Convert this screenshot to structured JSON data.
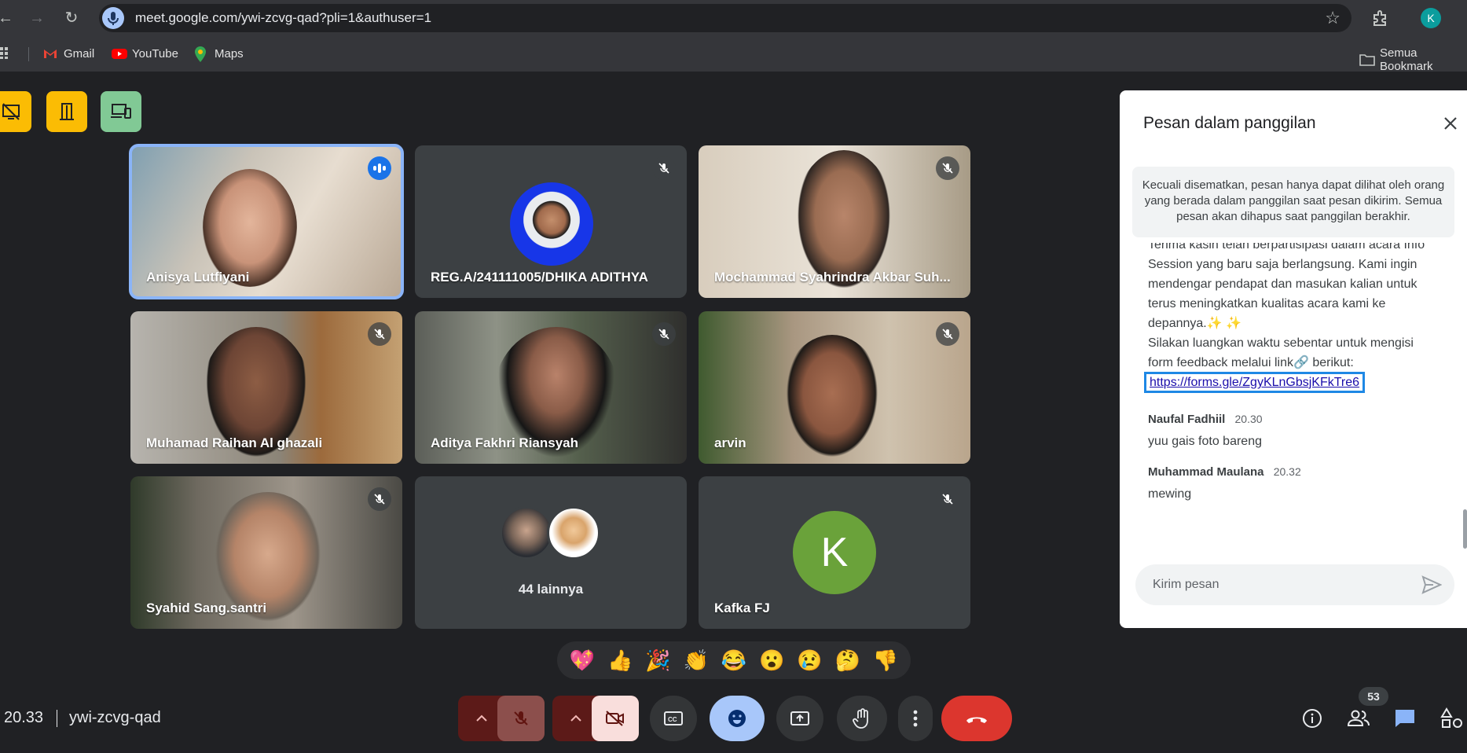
{
  "browser": {
    "url": "meet.google.com/ywi-zcvg-qad?pli=1&authuser=1",
    "profile_initial": "K",
    "bookmarks": [
      {
        "label": "Gmail",
        "icon": "gmail-icon"
      },
      {
        "label": "YouTube",
        "icon": "youtube-icon"
      },
      {
        "label": "Maps",
        "icon": "maps-icon"
      }
    ],
    "bookmarks_folder": "Semua Bookmark"
  },
  "participants": [
    {
      "name": "Anisya Lutfiyani",
      "state": "speaking"
    },
    {
      "name": "REG.A/241111005/DHIKA ADITHYA",
      "state": "muted"
    },
    {
      "name": "Mochammad Syahrindra Akbar Suh...",
      "state": "muted"
    },
    {
      "name": "Muhamad Raihan Al ghazali",
      "state": "muted"
    },
    {
      "name": "Aditya Fakhri Riansyah",
      "state": "muted"
    },
    {
      "name": "arvin",
      "state": "muted"
    },
    {
      "name": "Syahid Sang.santri",
      "state": "muted"
    },
    {
      "name": "44 lainnya",
      "state": "group"
    },
    {
      "name": "Kafka FJ",
      "state": "muted",
      "initial": "K"
    }
  ],
  "reactions": [
    "💖",
    "👍",
    "🎉",
    "👏",
    "😂",
    "😮",
    "😢",
    "🤔",
    "👎"
  ],
  "meeting": {
    "time": "20.33",
    "code": "ywi-zcvg-qad",
    "people_count": "53"
  },
  "chat": {
    "title": "Pesan dalam panggilan",
    "notice": "Kecuali disematkan, pesan hanya dapat dilihat oleh orang yang berada dalam panggilan saat pesan dikirim. Semua pesan akan dihapus saat panggilan berakhir.",
    "message_1_text": "Terima kasih telah berpartisipasi dalam acara Info Session yang baru saja berlangsung. Kami ingin mendengar pendapat dan masukan kalian untuk terus meningkatkan kualitas acara kami ke depannya.✨ ✨",
    "message_1_text2": "Silakan luangkan waktu sebentar untuk mengisi form feedback melalui link🔗 berikut:",
    "message_1_link": "https://forms.gle/ZgyKLnGbsjKFkTre6",
    "messages": [
      {
        "author": "Naufal Fadhiil",
        "time": "20.30",
        "text": "yuu gais foto bareng"
      },
      {
        "author": "Muhammad Maulana",
        "time": "20.32",
        "text": "mewing"
      }
    ],
    "input_placeholder": "Kirim pesan"
  },
  "colors": {
    "background": "#202124",
    "accent_blue": "#8ab4f8",
    "end_call_red": "#dc362e",
    "reaction_active": "#a8c7fa"
  }
}
